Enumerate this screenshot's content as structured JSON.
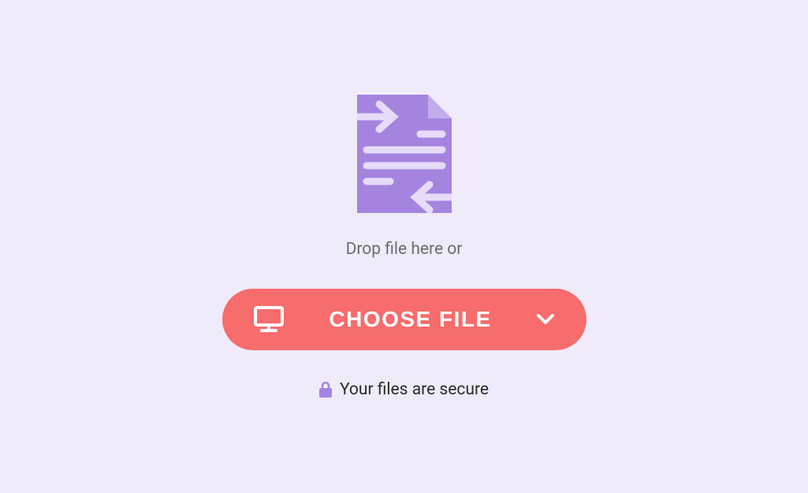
{
  "uploader": {
    "drop_text": "Drop file here or",
    "choose_button_label": "CHOOSE FILE",
    "secure_text": "Your files are secure"
  },
  "colors": {
    "background": "#F0EBFA",
    "button_bg": "#F76C6C",
    "button_text": "#FFFFFF",
    "file_icon_fill": "#A584E0",
    "file_icon_lines": "#D6C6F2",
    "drop_text_color": "#6B6B6B",
    "secure_text_color": "#2B2B2B",
    "lock_color": "#A584E0"
  }
}
